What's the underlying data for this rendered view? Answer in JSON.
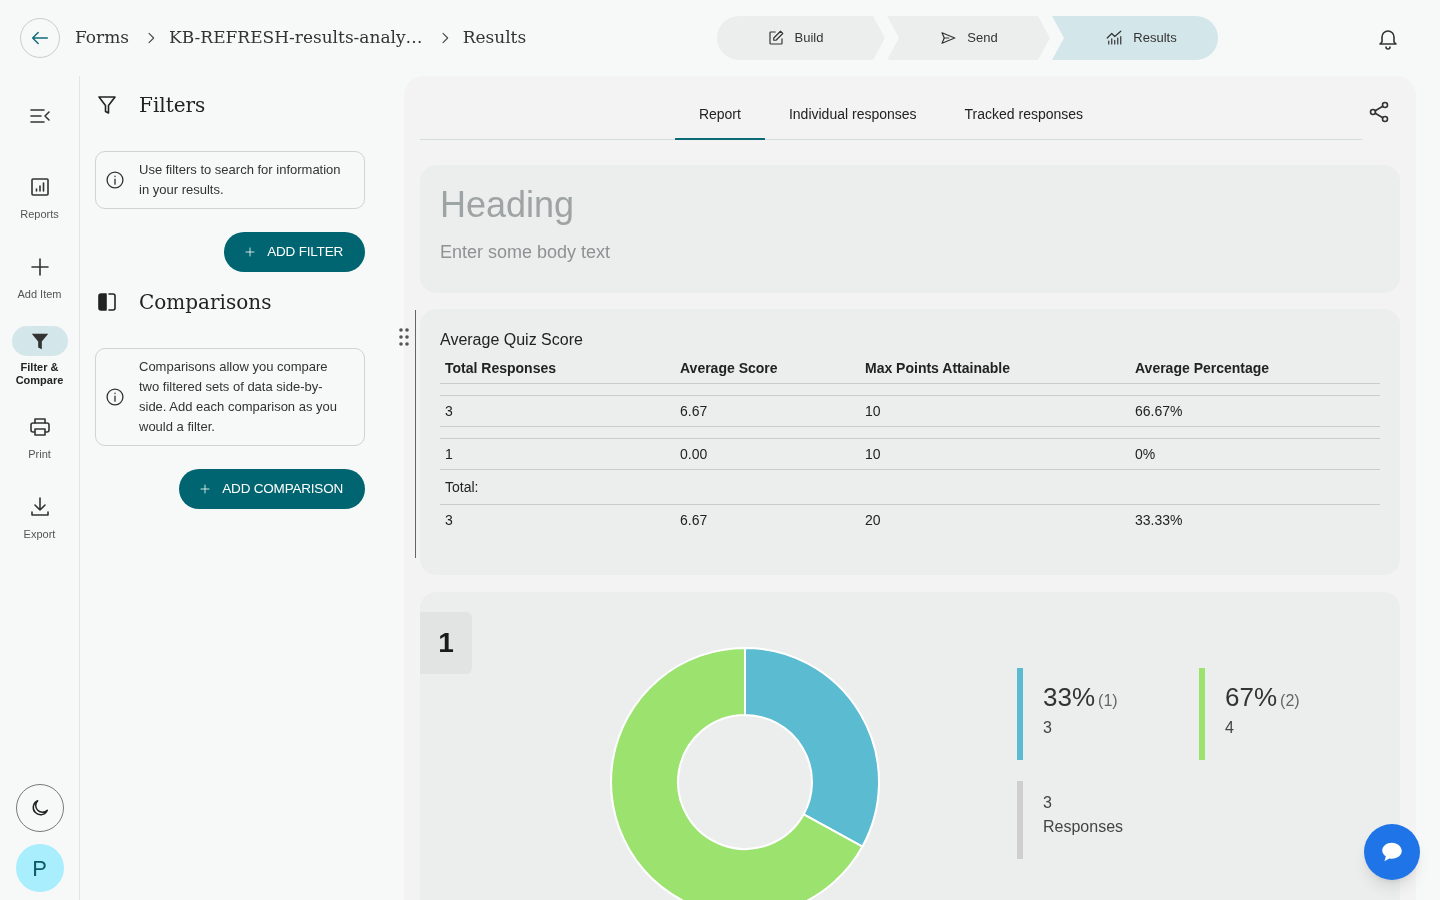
{
  "header": {
    "breadcrumbs": [
      "Forms",
      "KB-REFRESH-results-analy…",
      "Results"
    ],
    "steps": [
      {
        "label": "Build",
        "selected": false
      },
      {
        "label": "Send",
        "selected": false
      },
      {
        "label": "Results",
        "selected": true
      }
    ]
  },
  "nav_rail": {
    "items": [
      {
        "label": "Reports",
        "selected": false
      },
      {
        "label": "Add Item",
        "selected": false
      },
      {
        "label": "Filter & Compare",
        "selected": true
      },
      {
        "label": "Print",
        "selected": false
      },
      {
        "label": "Export",
        "selected": false
      }
    ],
    "avatar": "P"
  },
  "filters_panel": {
    "sections": [
      {
        "title": "Filters",
        "info": "Use filters to search for information in your results.",
        "button": "ADD FILTER"
      },
      {
        "title": "Comparisons",
        "info": "Comparisons allow you compare two filtered sets of data side-by-side. Add each comparison as you would a filter.",
        "button": "ADD COMPARISON"
      }
    ]
  },
  "tabs": [
    {
      "label": "Report",
      "selected": true
    },
    {
      "label": "Individual responses",
      "selected": false
    },
    {
      "label": "Tracked responses",
      "selected": false
    }
  ],
  "heading_card": {
    "heading": "Heading",
    "body": "Enter some body text"
  },
  "quiz_table": {
    "title": "Average Quiz Score",
    "columns": [
      "Total Responses",
      "Average Score",
      "Max Points Attainable",
      "Average Percentage"
    ],
    "rows": [
      [
        "3",
        "6.67",
        "10",
        "66.67%"
      ],
      [
        "1",
        "0.00",
        "10",
        "0%"
      ]
    ],
    "total_label": "Total:",
    "total_row": [
      "3",
      "6.67",
      "20",
      "33.33%"
    ]
  },
  "question": {
    "number": "1",
    "chart_data": {
      "type": "donut",
      "categories": [
        "3",
        "4"
      ],
      "series": [
        {
          "name": "Responses",
          "values": [
            33,
            67
          ]
        }
      ]
    },
    "legend": [
      {
        "percent": "33%",
        "count": "(1)",
        "color": "#5bbbd0"
      },
      {
        "percent": "67%",
        "count": "(2)",
        "color": "#9be26f"
      }
    ],
    "total": {
      "count": "3"
    }
  }
}
